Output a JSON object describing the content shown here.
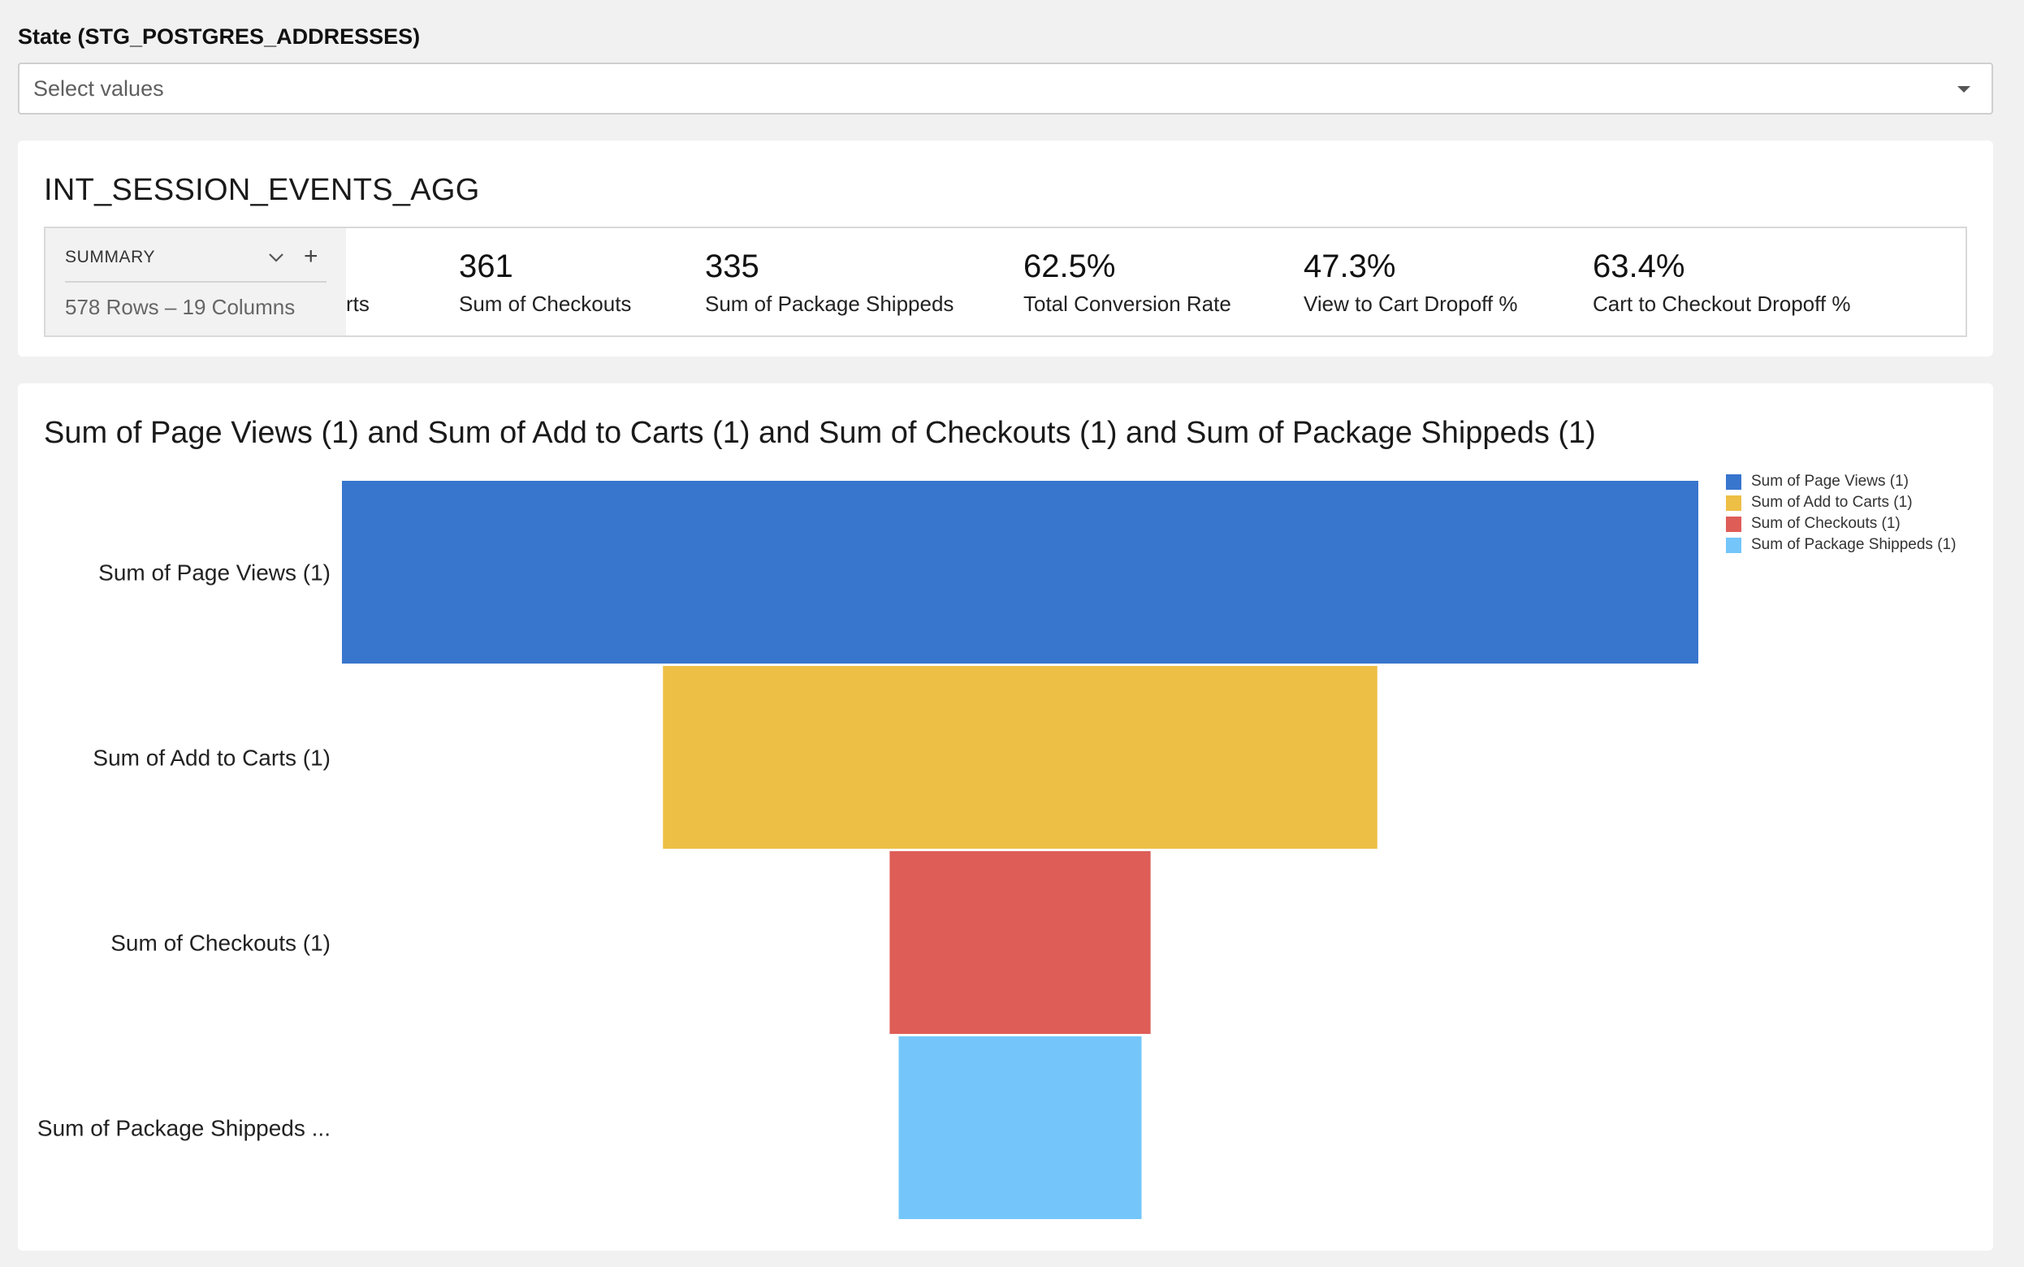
{
  "filter": {
    "label": "State (STG_POSTGRES_ADDRESSES)",
    "placeholder": "Select values"
  },
  "summary_card": {
    "title": "INT_SESSION_EVENTS_AGG",
    "summary_label": "SUMMARY",
    "rows_columns": "578 Rows – 19 Columns",
    "partial_label": "rts",
    "kpis": [
      {
        "value": "361",
        "label": "Sum of Checkouts"
      },
      {
        "value": "335",
        "label": "Sum of Package Shippeds"
      },
      {
        "value": "62.5%",
        "label": "Total Conversion Rate"
      },
      {
        "value": "47.3%",
        "label": "View to Cart Dropoff %"
      },
      {
        "value": "63.4%",
        "label": "Cart to Checkout Dropoff %"
      }
    ]
  },
  "chart_data": {
    "type": "funnel",
    "title": "Sum of Page Views (1) and Sum of Add to Carts (1) and Sum of Checkouts (1) and Sum of Package Shippeds (1)",
    "categories": [
      "Sum of Page Views (1)",
      "Sum of Add to Carts (1)",
      "Sum of Checkouts (1)",
      "Sum of Package Shippeds ..."
    ],
    "series": [
      {
        "name": "Sum of Page Views (1)",
        "value": 1050,
        "color": "#3875CD"
      },
      {
        "name": "Sum of Add to Carts (1)",
        "value": 553,
        "color": "#EDBF45"
      },
      {
        "name": "Sum of Checkouts (1)",
        "value": 202,
        "color": "#DE5D57"
      },
      {
        "name": "Sum of Package Shippeds (1)",
        "value": 188,
        "color": "#74C6FA"
      }
    ],
    "legend_position": "top-right",
    "grid": false
  }
}
